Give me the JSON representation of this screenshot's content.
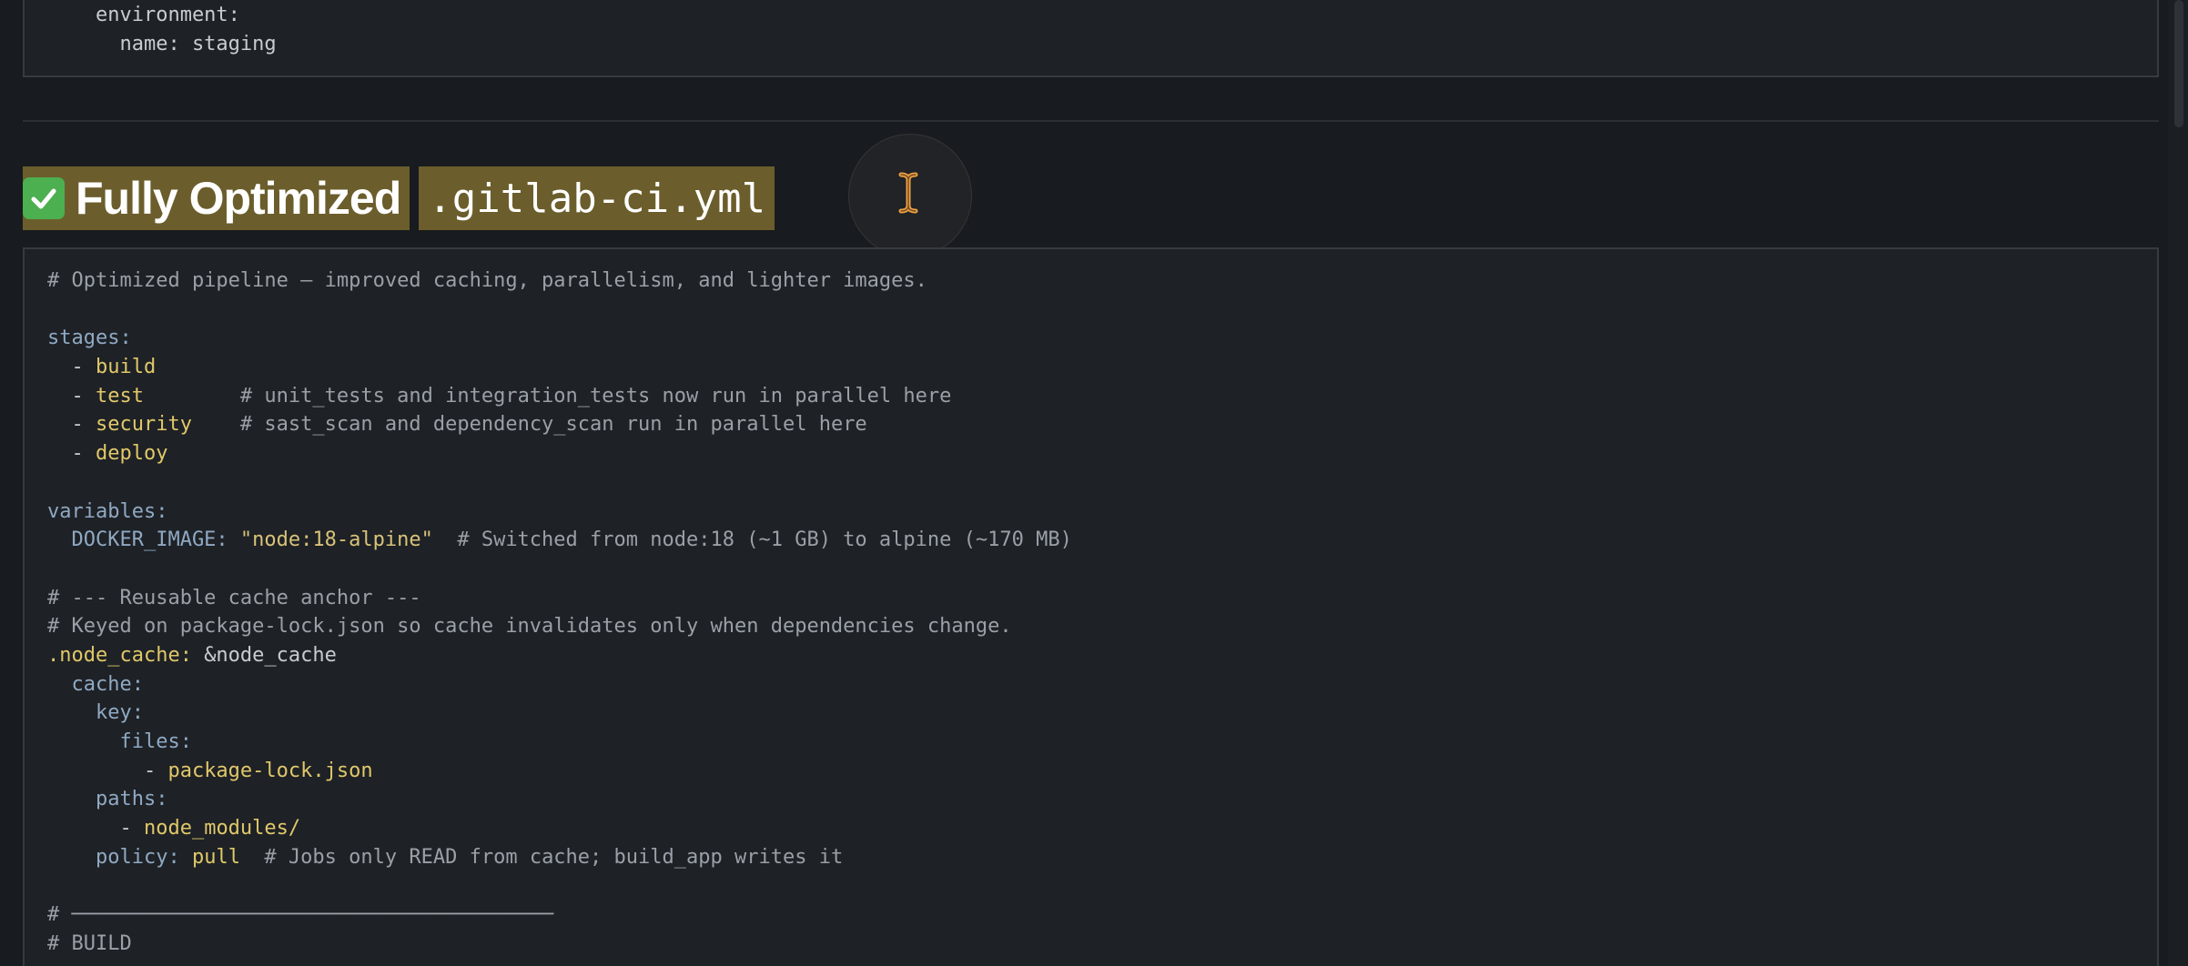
{
  "top_block": {
    "lines": [
      [
        {
          "t": "    environment:",
          "c": "plain"
        }
      ],
      [
        {
          "t": "      name: staging",
          "c": "plain"
        }
      ]
    ]
  },
  "heading": {
    "emoji_icon": "white-check-mark-icon",
    "text": "Fully Optimized",
    "code": ".gitlab-ci.yml"
  },
  "main_block": {
    "lines": [
      [
        {
          "t": "# Optimized pipeline — improved caching, parallelism, and lighter images.",
          "c": "comment"
        }
      ],
      [],
      [
        {
          "t": "stages:",
          "c": "key"
        }
      ],
      [
        {
          "t": "  - ",
          "c": "plain"
        },
        {
          "t": "build",
          "c": "val"
        }
      ],
      [
        {
          "t": "  - ",
          "c": "plain"
        },
        {
          "t": "test",
          "c": "val"
        },
        {
          "t": "        # unit_tests and integration_tests now run in parallel here",
          "c": "comment"
        }
      ],
      [
        {
          "t": "  - ",
          "c": "plain"
        },
        {
          "t": "security",
          "c": "val"
        },
        {
          "t": "    # sast_scan and dependency_scan run in parallel here",
          "c": "comment"
        }
      ],
      [
        {
          "t": "  - ",
          "c": "plain"
        },
        {
          "t": "deploy",
          "c": "val"
        }
      ],
      [],
      [
        {
          "t": "variables:",
          "c": "key"
        }
      ],
      [
        {
          "t": "  DOCKER_IMAGE: ",
          "c": "key"
        },
        {
          "t": "\"node:18-alpine\"",
          "c": "str"
        },
        {
          "t": "  # Switched from node:18 (~1 GB) to alpine (~170 MB)",
          "c": "comment"
        }
      ],
      [],
      [
        {
          "t": "# --- Reusable cache anchor ---",
          "c": "comment"
        }
      ],
      [
        {
          "t": "# Keyed on package-lock.json so cache invalidates only when dependencies change.",
          "c": "comment"
        }
      ],
      [
        {
          "t": ".node_cache: ",
          "c": "val"
        },
        {
          "t": "&node_cache",
          "c": "plain"
        }
      ],
      [
        {
          "t": "  cache:",
          "c": "key"
        }
      ],
      [
        {
          "t": "    key:",
          "c": "key"
        }
      ],
      [
        {
          "t": "      files:",
          "c": "key"
        }
      ],
      [
        {
          "t": "        - ",
          "c": "plain"
        },
        {
          "t": "package-lock.json",
          "c": "val"
        }
      ],
      [
        {
          "t": "    paths:",
          "c": "key"
        }
      ],
      [
        {
          "t": "      - ",
          "c": "plain"
        },
        {
          "t": "node_modules/",
          "c": "val"
        }
      ],
      [
        {
          "t": "    policy: ",
          "c": "key"
        },
        {
          "t": "pull",
          "c": "val"
        },
        {
          "t": "  # Jobs only READ from cache; build_app writes it",
          "c": "comment"
        }
      ],
      [],
      [
        {
          "t": "# ────────────────────────────────────────",
          "c": "comment"
        }
      ],
      [
        {
          "t": "# BUILD",
          "c": "comment"
        }
      ]
    ]
  }
}
